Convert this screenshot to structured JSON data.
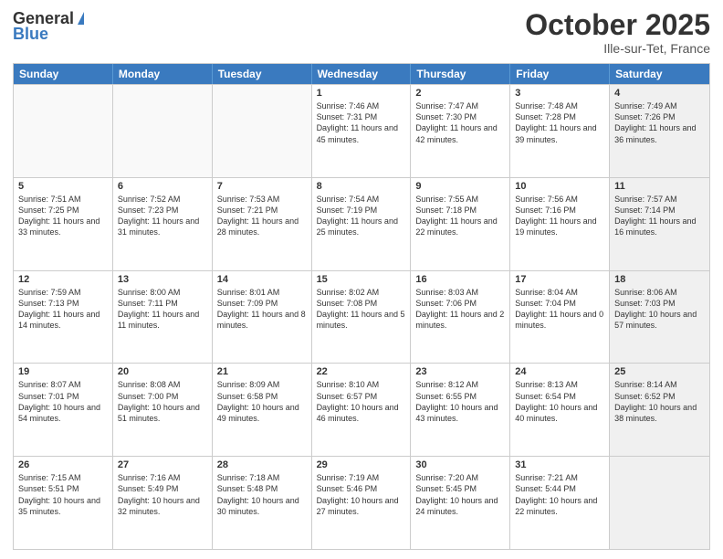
{
  "header": {
    "logo_general": "General",
    "logo_blue": "Blue",
    "month_title": "October 2025",
    "location": "Ille-sur-Tet, France"
  },
  "days_of_week": [
    "Sunday",
    "Monday",
    "Tuesday",
    "Wednesday",
    "Thursday",
    "Friday",
    "Saturday"
  ],
  "weeks": [
    [
      {
        "day": "",
        "info": "",
        "empty": true
      },
      {
        "day": "",
        "info": "",
        "empty": true
      },
      {
        "day": "",
        "info": "",
        "empty": true
      },
      {
        "day": "1",
        "info": "Sunrise: 7:46 AM\nSunset: 7:31 PM\nDaylight: 11 hours and 45 minutes."
      },
      {
        "day": "2",
        "info": "Sunrise: 7:47 AM\nSunset: 7:30 PM\nDaylight: 11 hours and 42 minutes."
      },
      {
        "day": "3",
        "info": "Sunrise: 7:48 AM\nSunset: 7:28 PM\nDaylight: 11 hours and 39 minutes."
      },
      {
        "day": "4",
        "info": "Sunrise: 7:49 AM\nSunset: 7:26 PM\nDaylight: 11 hours and 36 minutes.",
        "shaded": true
      }
    ],
    [
      {
        "day": "5",
        "info": "Sunrise: 7:51 AM\nSunset: 7:25 PM\nDaylight: 11 hours and 33 minutes."
      },
      {
        "day": "6",
        "info": "Sunrise: 7:52 AM\nSunset: 7:23 PM\nDaylight: 11 hours and 31 minutes."
      },
      {
        "day": "7",
        "info": "Sunrise: 7:53 AM\nSunset: 7:21 PM\nDaylight: 11 hours and 28 minutes."
      },
      {
        "day": "8",
        "info": "Sunrise: 7:54 AM\nSunset: 7:19 PM\nDaylight: 11 hours and 25 minutes."
      },
      {
        "day": "9",
        "info": "Sunrise: 7:55 AM\nSunset: 7:18 PM\nDaylight: 11 hours and 22 minutes."
      },
      {
        "day": "10",
        "info": "Sunrise: 7:56 AM\nSunset: 7:16 PM\nDaylight: 11 hours and 19 minutes."
      },
      {
        "day": "11",
        "info": "Sunrise: 7:57 AM\nSunset: 7:14 PM\nDaylight: 11 hours and 16 minutes.",
        "shaded": true
      }
    ],
    [
      {
        "day": "12",
        "info": "Sunrise: 7:59 AM\nSunset: 7:13 PM\nDaylight: 11 hours and 14 minutes."
      },
      {
        "day": "13",
        "info": "Sunrise: 8:00 AM\nSunset: 7:11 PM\nDaylight: 11 hours and 11 minutes."
      },
      {
        "day": "14",
        "info": "Sunrise: 8:01 AM\nSunset: 7:09 PM\nDaylight: 11 hours and 8 minutes."
      },
      {
        "day": "15",
        "info": "Sunrise: 8:02 AM\nSunset: 7:08 PM\nDaylight: 11 hours and 5 minutes."
      },
      {
        "day": "16",
        "info": "Sunrise: 8:03 AM\nSunset: 7:06 PM\nDaylight: 11 hours and 2 minutes."
      },
      {
        "day": "17",
        "info": "Sunrise: 8:04 AM\nSunset: 7:04 PM\nDaylight: 11 hours and 0 minutes."
      },
      {
        "day": "18",
        "info": "Sunrise: 8:06 AM\nSunset: 7:03 PM\nDaylight: 10 hours and 57 minutes.",
        "shaded": true
      }
    ],
    [
      {
        "day": "19",
        "info": "Sunrise: 8:07 AM\nSunset: 7:01 PM\nDaylight: 10 hours and 54 minutes."
      },
      {
        "day": "20",
        "info": "Sunrise: 8:08 AM\nSunset: 7:00 PM\nDaylight: 10 hours and 51 minutes."
      },
      {
        "day": "21",
        "info": "Sunrise: 8:09 AM\nSunset: 6:58 PM\nDaylight: 10 hours and 49 minutes."
      },
      {
        "day": "22",
        "info": "Sunrise: 8:10 AM\nSunset: 6:57 PM\nDaylight: 10 hours and 46 minutes."
      },
      {
        "day": "23",
        "info": "Sunrise: 8:12 AM\nSunset: 6:55 PM\nDaylight: 10 hours and 43 minutes."
      },
      {
        "day": "24",
        "info": "Sunrise: 8:13 AM\nSunset: 6:54 PM\nDaylight: 10 hours and 40 minutes."
      },
      {
        "day": "25",
        "info": "Sunrise: 8:14 AM\nSunset: 6:52 PM\nDaylight: 10 hours and 38 minutes.",
        "shaded": true
      }
    ],
    [
      {
        "day": "26",
        "info": "Sunrise: 7:15 AM\nSunset: 5:51 PM\nDaylight: 10 hours and 35 minutes."
      },
      {
        "day": "27",
        "info": "Sunrise: 7:16 AM\nSunset: 5:49 PM\nDaylight: 10 hours and 32 minutes."
      },
      {
        "day": "28",
        "info": "Sunrise: 7:18 AM\nSunset: 5:48 PM\nDaylight: 10 hours and 30 minutes."
      },
      {
        "day": "29",
        "info": "Sunrise: 7:19 AM\nSunset: 5:46 PM\nDaylight: 10 hours and 27 minutes."
      },
      {
        "day": "30",
        "info": "Sunrise: 7:20 AM\nSunset: 5:45 PM\nDaylight: 10 hours and 24 minutes."
      },
      {
        "day": "31",
        "info": "Sunrise: 7:21 AM\nSunset: 5:44 PM\nDaylight: 10 hours and 22 minutes."
      },
      {
        "day": "",
        "info": "",
        "empty": true,
        "shaded": true
      }
    ]
  ]
}
